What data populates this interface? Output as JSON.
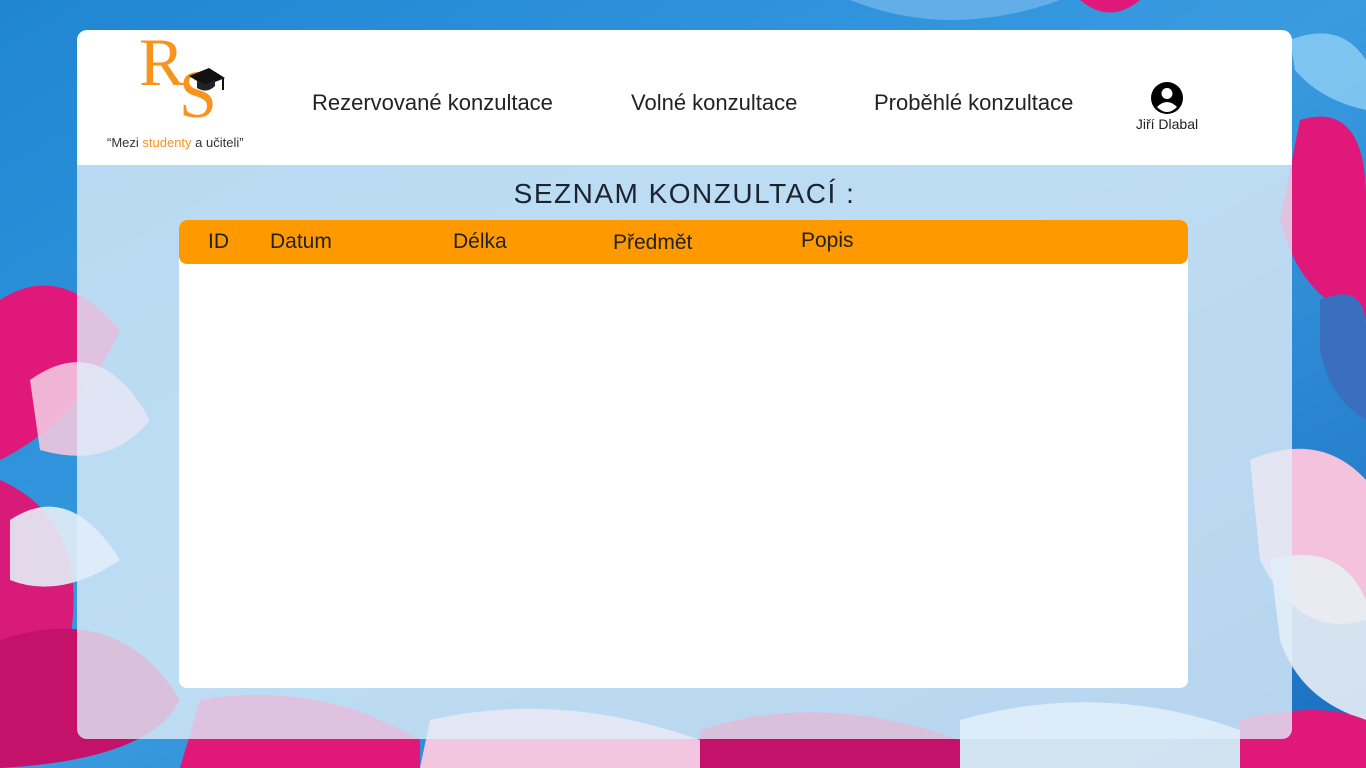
{
  "logo": {
    "letter_r": "R",
    "letter_s": "S",
    "slogan_prefix": "“Mezi ",
    "slogan_accent": "studenty",
    "slogan_suffix": " a učiteli”"
  },
  "nav": {
    "reserved": "Rezervované konzultace",
    "free": "Volné konzultace",
    "past": "Proběhlé konzultace"
  },
  "user": {
    "name": "Jiří Dlabal",
    "icon": "account-circle-icon"
  },
  "list": {
    "title": "SEZNAM KONZULTACÍ :",
    "columns": {
      "id": "ID",
      "date": "Datum",
      "length": "Délka",
      "subject": "Předmět",
      "description": "Popis"
    },
    "rows": []
  },
  "colors": {
    "accent": "#ff9900",
    "logo": "#f7941d",
    "background": "#2a86d6"
  }
}
